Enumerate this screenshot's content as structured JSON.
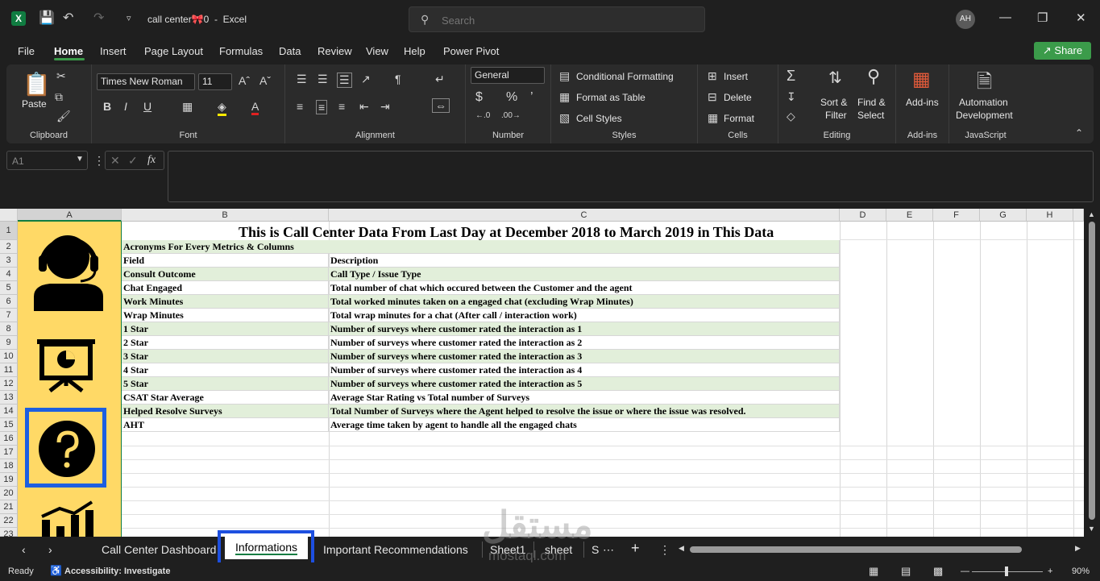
{
  "titlebar": {
    "file_name": "call center🎀0",
    "separator": "-",
    "app": "Excel",
    "search_placeholder": "Search",
    "user_initials": "AH"
  },
  "menu": [
    "File",
    "Home",
    "Insert",
    "Page Layout",
    "Formulas",
    "Data",
    "Review",
    "View",
    "Help",
    "Power Pivot"
  ],
  "share_label": "Share",
  "ribbon": {
    "clipboard": {
      "paste": "Paste",
      "label": "Clipboard"
    },
    "font": {
      "family": "Times New Roman",
      "size": "11",
      "label": "Font"
    },
    "alignment": {
      "label": "Alignment"
    },
    "number": {
      "format": "General",
      "label": "Number"
    },
    "styles": {
      "conditional": "Conditional Formatting",
      "table": "Format as Table",
      "cell": "Cell Styles",
      "label": "Styles"
    },
    "cells": {
      "insert": "Insert",
      "delete": "Delete",
      "format": "Format",
      "label": "Cells"
    },
    "editing": {
      "sort_1": "Sort &",
      "sort_2": "Filter",
      "find_1": "Find &",
      "find_2": "Select",
      "label": "Editing"
    },
    "addins": {
      "button": "Add-ins",
      "label": "Add-ins"
    },
    "javascript": {
      "line1": "Automation",
      "line2": "Development",
      "label": "JavaScript"
    }
  },
  "name_box": "A1",
  "columns": [
    "A",
    "B",
    "C",
    "D",
    "E",
    "F",
    "G",
    "H"
  ],
  "rows": [
    "1",
    "2",
    "3",
    "4",
    "5",
    "6",
    "7",
    "8",
    "9",
    "10",
    "11",
    "12",
    "13",
    "14",
    "15",
    "16",
    "17",
    "18",
    "19",
    "20",
    "21",
    "22",
    "23"
  ],
  "sheet": {
    "title": "This is Call Center Data From Last Day at December 2018 to March 2019 in This Data",
    "subtitle": "Acronyms For Every Metrics & Columns",
    "header": {
      "field": "Field",
      "description": "Description"
    },
    "entries": [
      {
        "field": "Consult Outcome",
        "description": "Call Type / Issue Type"
      },
      {
        "field": "Chat Engaged",
        "description": "Total number of chat which occured between the Customer and the agent"
      },
      {
        "field": "Work Minutes",
        "description": "Total worked minutes taken on a engaged chat (excluding Wrap Minutes)"
      },
      {
        "field": "Wrap Minutes",
        "description": "Total wrap minutes for a chat (After call / interaction work)"
      },
      {
        "field": "1 Star",
        "description": "Number of surveys where customer rated the interaction as 1"
      },
      {
        "field": "2 Star",
        "description": "Number of surveys where customer rated the interaction as 2"
      },
      {
        "field": "3 Star",
        "description": "Number of surveys where customer rated the interaction as 3"
      },
      {
        "field": "4 Star",
        "description": "Number of surveys where customer rated the interaction as 4"
      },
      {
        "field": "5 Star",
        "description": "Number of surveys where customer rated the interaction as 5"
      },
      {
        "field": "CSAT Star Average",
        "description": "Average Star Rating vs Total number of Surveys"
      },
      {
        "field": "Helped Resolve Surveys",
        "description": "Total Number of Surveys where the Agent helped to resolve the issue or where the issue was resolved."
      },
      {
        "field": "AHT",
        "description": "Average time taken by agent to handle all the engaged chats"
      }
    ]
  },
  "tabs": [
    "Call Center Dashboard",
    "Informations",
    "Important Recommendations",
    "Sheet1",
    "sheet",
    "S"
  ],
  "status": {
    "ready": "Ready",
    "accessibility": "Accessibility: Investigate",
    "zoom": "90%"
  },
  "watermark": {
    "arabic": "مستقل",
    "latin": "mostaql.com"
  },
  "colors": {
    "accent": "#107c41",
    "highlight": "#1d5fe0",
    "yellow": "#ffd966",
    "green_band": "#e2efda"
  }
}
